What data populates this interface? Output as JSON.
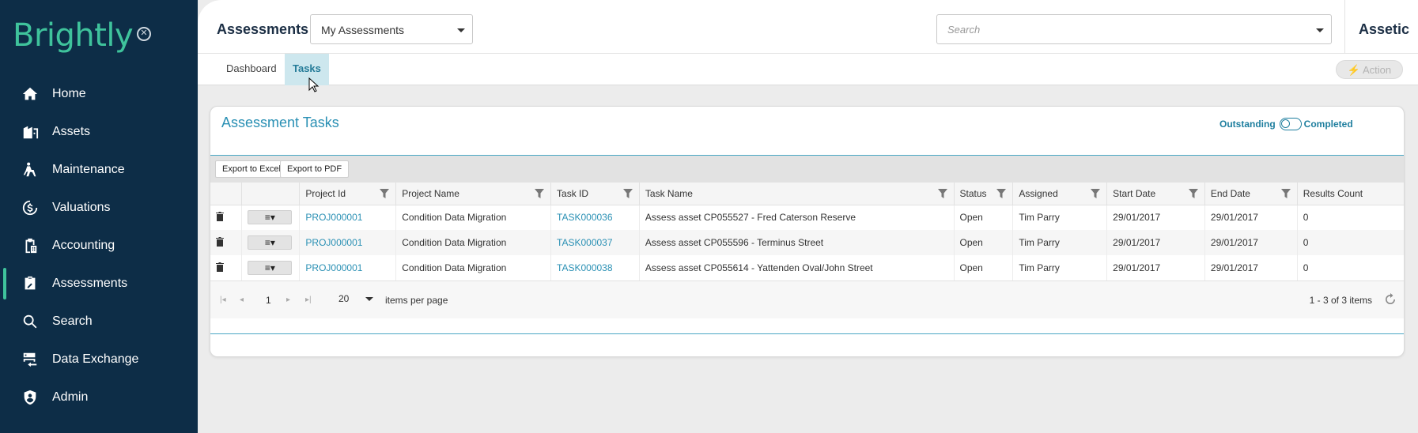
{
  "sidebar": {
    "logo": "Brightly",
    "close_icon": "close-circle-icon",
    "items": [
      {
        "label": "Home",
        "icon": "home-icon",
        "active": false
      },
      {
        "label": "Assets",
        "icon": "buildings-icon",
        "active": false
      },
      {
        "label": "Maintenance",
        "icon": "worker-icon",
        "active": false
      },
      {
        "label": "Valuations",
        "icon": "dollar-icon",
        "active": false
      },
      {
        "label": "Accounting",
        "icon": "clipboard-building-icon",
        "active": false
      },
      {
        "label": "Assessments",
        "icon": "clipboard-edit-icon",
        "active": true
      },
      {
        "label": "Search",
        "icon": "search-icon",
        "active": false
      },
      {
        "label": "Data Exchange",
        "icon": "data-exchange-icon",
        "active": false
      },
      {
        "label": "Admin",
        "icon": "shield-user-icon",
        "active": false
      }
    ]
  },
  "header": {
    "title": "Assessments",
    "selector_value": "My Assessments",
    "search_placeholder": "Search",
    "brand": "Assetic"
  },
  "tabs": {
    "items": [
      {
        "label": "Dashboard",
        "active": false
      },
      {
        "label": "Tasks",
        "active": true
      }
    ],
    "action_label": "Action"
  },
  "card": {
    "title": "Assessment Tasks",
    "toggle_left": "Outstanding",
    "toggle_right": "Completed",
    "export_excel": "Export to Excel",
    "export_pdf": "Export to PDF",
    "columns": [
      "Project Id",
      "Project Name",
      "Task ID",
      "Task Name",
      "Status",
      "Assigned",
      "Start Date",
      "End Date",
      "Results Count"
    ],
    "rows": [
      {
        "project_id": "PROJ000001",
        "project_name": "Condition Data Migration",
        "task_id": "TASK000036",
        "task_name": "Assess asset CP055527 - Fred Caterson Reserve",
        "status": "Open",
        "assigned": "Tim Parry",
        "start": "29/01/2017",
        "end": "29/01/2017",
        "results": "0"
      },
      {
        "project_id": "PROJ000001",
        "project_name": "Condition Data Migration",
        "task_id": "TASK000037",
        "task_name": "Assess asset CP055596 - Terminus Street",
        "status": "Open",
        "assigned": "Tim Parry",
        "start": "29/01/2017",
        "end": "29/01/2017",
        "results": "0"
      },
      {
        "project_id": "PROJ000001",
        "project_name": "Condition Data Migration",
        "task_id": "TASK000038",
        "task_name": "Assess asset CP055614 - Yattenden Oval/John Street",
        "status": "Open",
        "assigned": "Tim Parry",
        "start": "29/01/2017",
        "end": "29/01/2017",
        "results": "0"
      }
    ],
    "row_menu_label": "≡▾",
    "pager": {
      "page": "1",
      "page_size": "20",
      "items_per_page_label": "items per page",
      "count_label": "1 - 3 of 3 items"
    }
  },
  "colors": {
    "sidebar_bg": "#0d2d47",
    "brand_green": "#3fc39c",
    "accent_blue": "#2a90b4"
  }
}
